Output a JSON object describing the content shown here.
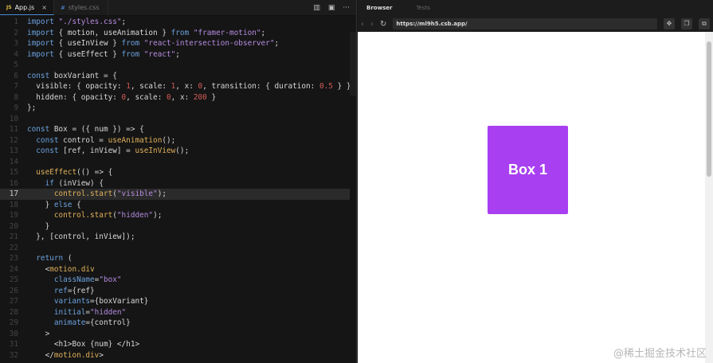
{
  "editor": {
    "tabs": [
      {
        "label": "App.js",
        "lang": "JS",
        "close": "×"
      },
      {
        "label": "styles.css",
        "lang": "#"
      }
    ],
    "tools": [
      "▥",
      "▣",
      "···"
    ],
    "highlight_line": 17,
    "lines": [
      [
        [
          "k",
          "import "
        ],
        [
          "s",
          "\"./styles.css\""
        ],
        [
          "t",
          ";"
        ]
      ],
      [
        [
          "k",
          "import "
        ],
        [
          "t",
          "{ motion, useAnimation } "
        ],
        [
          "k",
          "from "
        ],
        [
          "s",
          "\"framer-motion\""
        ],
        [
          "t",
          ";"
        ]
      ],
      [
        [
          "k",
          "import "
        ],
        [
          "t",
          "{ useInView } "
        ],
        [
          "k",
          "from "
        ],
        [
          "s",
          "\"react-intersection-observer\""
        ],
        [
          "t",
          ";"
        ]
      ],
      [
        [
          "k",
          "import "
        ],
        [
          "t",
          "{ useEffect } "
        ],
        [
          "k",
          "from "
        ],
        [
          "s",
          "\"react\""
        ],
        [
          "t",
          ";"
        ]
      ],
      [],
      [
        [
          "k",
          "const "
        ],
        [
          "t",
          "boxVariant = {"
        ]
      ],
      [
        [
          "t",
          "  visible: { opacity: "
        ],
        [
          "n",
          "1"
        ],
        [
          "t",
          ", scale: "
        ],
        [
          "n",
          "1"
        ],
        [
          "t",
          ", x: "
        ],
        [
          "n",
          "0"
        ],
        [
          "t",
          ", transition: { duration: "
        ],
        [
          "n",
          "0.5"
        ],
        [
          "t",
          " } },"
        ]
      ],
      [
        [
          "t",
          "  hidden: { opacity: "
        ],
        [
          "n",
          "0"
        ],
        [
          "t",
          ", scale: "
        ],
        [
          "n",
          "0"
        ],
        [
          "t",
          ", x: "
        ],
        [
          "n",
          "200"
        ],
        [
          "t",
          " }"
        ]
      ],
      [
        [
          "t",
          "};"
        ]
      ],
      [],
      [
        [
          "k",
          "const "
        ],
        [
          "t",
          "Box = ({ num }) => {"
        ]
      ],
      [
        [
          "k",
          "  const "
        ],
        [
          "t",
          "control = "
        ],
        [
          "f",
          "useAnimation"
        ],
        [
          "t",
          "();"
        ]
      ],
      [
        [
          "k",
          "  const "
        ],
        [
          "t",
          "[ref, inView] = "
        ],
        [
          "f",
          "useInView"
        ],
        [
          "t",
          "();"
        ]
      ],
      [],
      [
        [
          "f",
          "  useEffect"
        ],
        [
          "t",
          "(() => {"
        ]
      ],
      [
        [
          "k",
          "    if "
        ],
        [
          "t",
          "(inView) {"
        ]
      ],
      [
        [
          "f",
          "      control.start"
        ],
        [
          "t",
          "("
        ],
        [
          "s",
          "\"visible\""
        ],
        [
          "t",
          ");"
        ]
      ],
      [
        [
          "t",
          "    } "
        ],
        [
          "k",
          "else "
        ],
        [
          "t",
          "{"
        ]
      ],
      [
        [
          "f",
          "      control.start"
        ],
        [
          "t",
          "("
        ],
        [
          "s",
          "\"hidden\""
        ],
        [
          "t",
          ");"
        ]
      ],
      [
        [
          "t",
          "    }"
        ]
      ],
      [
        [
          "t",
          "  }, [control, inView]);"
        ]
      ],
      [],
      [
        [
          "k",
          "  return "
        ],
        [
          "t",
          "("
        ]
      ],
      [
        [
          "t",
          "    <"
        ],
        [
          "f",
          "motion.div"
        ]
      ],
      [
        [
          "k",
          "      className"
        ],
        [
          "t",
          "="
        ],
        [
          "s",
          "\"box\""
        ]
      ],
      [
        [
          "k",
          "      ref"
        ],
        [
          "t",
          "={ref}"
        ]
      ],
      [
        [
          "k",
          "      variants"
        ],
        [
          "t",
          "={boxVariant}"
        ]
      ],
      [
        [
          "k",
          "      initial"
        ],
        [
          "t",
          "="
        ],
        [
          "s",
          "\"hidden\""
        ]
      ],
      [
        [
          "k",
          "      animate"
        ],
        [
          "t",
          "={control}"
        ]
      ],
      [
        [
          "t",
          "    >"
        ]
      ],
      [
        [
          "t",
          "      <h1>Box {num} </h1>"
        ]
      ],
      [
        [
          "t",
          "    </"
        ],
        [
          "f",
          "motion.div"
        ],
        [
          "t",
          ">"
        ]
      ]
    ]
  },
  "browser": {
    "tabs": [
      "Browser",
      "Tests"
    ],
    "nav": [
      "‹",
      "›",
      "↻"
    ],
    "url": "https://ml9h5.csb.app/",
    "actions": [
      "✥",
      "❐",
      "⧉"
    ],
    "box_label": "Box 1"
  },
  "watermark": "@稀土掘金技术社区"
}
